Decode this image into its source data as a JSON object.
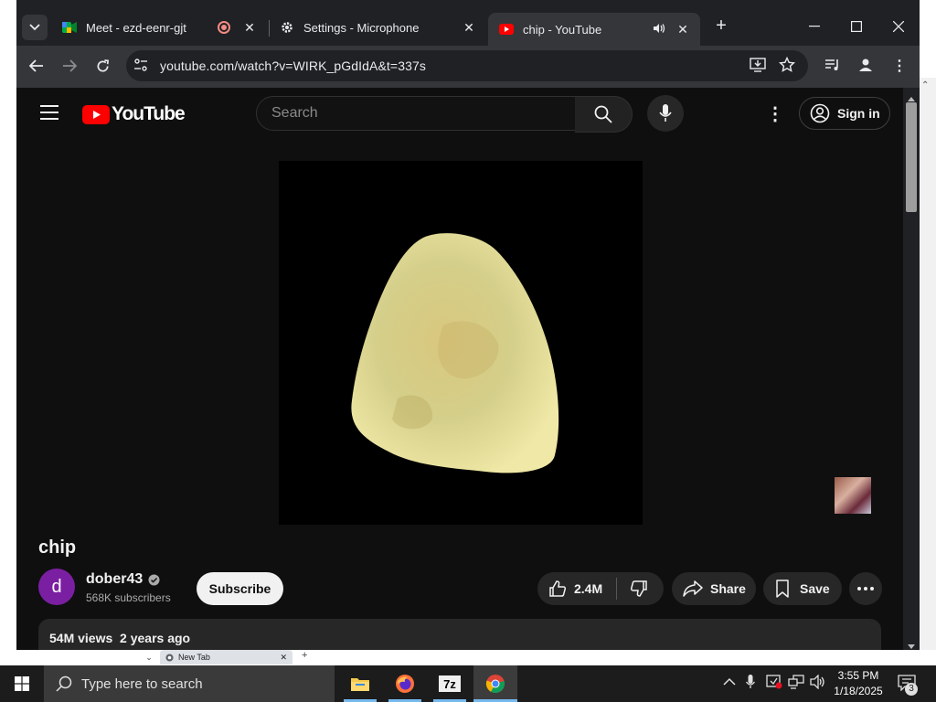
{
  "browser": {
    "tabs": [
      {
        "title": "Meet - ezd-eenr-gjt",
        "favicon": "google-meet-icon",
        "indicator": "recording-icon",
        "active": false
      },
      {
        "title": "Settings - Microphone",
        "favicon": "gear-icon",
        "active": false
      },
      {
        "title": "chip - YouTube",
        "favicon": "youtube-icon",
        "indicator": "speaker-icon",
        "active": true
      }
    ],
    "new_tab": "+",
    "url": "youtube.com/watch?v=WIRK_pGdIdA&t=337s",
    "lower_tab_title": "New Tab"
  },
  "youtube": {
    "logo_text": "YouTube",
    "search_placeholder": "Search",
    "sign_in": "Sign in",
    "video": {
      "title": "chip",
      "channel": "dober43",
      "channel_initial": "d",
      "subscribers": "568K subscribers",
      "subscribe_label": "Subscribe",
      "likes": "2.4M",
      "share_label": "Share",
      "save_label": "Save",
      "views": "54M views",
      "age": "2 years ago"
    },
    "colors": {
      "brand_red": "#ff0000",
      "background": "#0f0f0f",
      "avatar": "#7b1fa2"
    }
  },
  "taskbar": {
    "search_placeholder": "Type here to search",
    "apps": [
      "file-explorer-icon",
      "firefox-icon",
      "7zip-icon",
      "chrome-icon"
    ],
    "time": "3:55 PM",
    "date": "1/18/2025",
    "notifications": "3"
  }
}
